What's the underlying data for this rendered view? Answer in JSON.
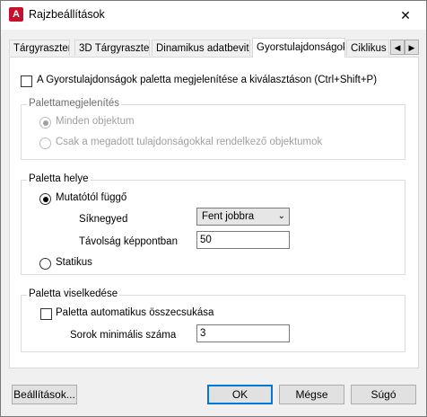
{
  "window": {
    "title": "Rajzbeállítások",
    "close_glyph": "✕"
  },
  "tabs": [
    {
      "label": "Tárgyraszter"
    },
    {
      "label": "3D Tárgyraszter"
    },
    {
      "label": "Dinamikus adatbevitel"
    },
    {
      "label": "Gyorstulajdonságok",
      "active": true
    },
    {
      "label": "Ciklikus k"
    }
  ],
  "tab_scroll": {
    "left_glyph": "◀",
    "right_glyph": "▶"
  },
  "show_palette": {
    "label": "A Gyorstulajdonságok paletta megjelenítése a kiválasztáson (Ctrl+Shift+P)",
    "checked": false
  },
  "palette_display": {
    "title": "Palettamegjelenítés",
    "options": [
      {
        "label": "Minden objektum",
        "checked": true,
        "disabled": true
      },
      {
        "label": "Csak a megadott tulajdonságokkal rendelkező objektumok",
        "checked": false,
        "disabled": true
      }
    ]
  },
  "palette_location": {
    "title": "Paletta helye",
    "cursor_option": {
      "label": "Mutatótól függő",
      "checked": true
    },
    "quadrant_label": "Síknegyed",
    "quadrant_value": "Fent jobbra",
    "distance_label": "Távolság képpontban",
    "distance_value": "50",
    "static_option": {
      "label": "Statikus",
      "checked": false
    }
  },
  "palette_behavior": {
    "title": "Paletta viselkedése",
    "collapse_label": "Paletta automatikus összecsukása",
    "collapse_checked": false,
    "min_rows_label": "Sorok minimális száma",
    "min_rows_value": "3"
  },
  "buttons": {
    "options": "Beállítások...",
    "ok": "OK",
    "cancel": "Mégse",
    "help": "Súgó"
  }
}
